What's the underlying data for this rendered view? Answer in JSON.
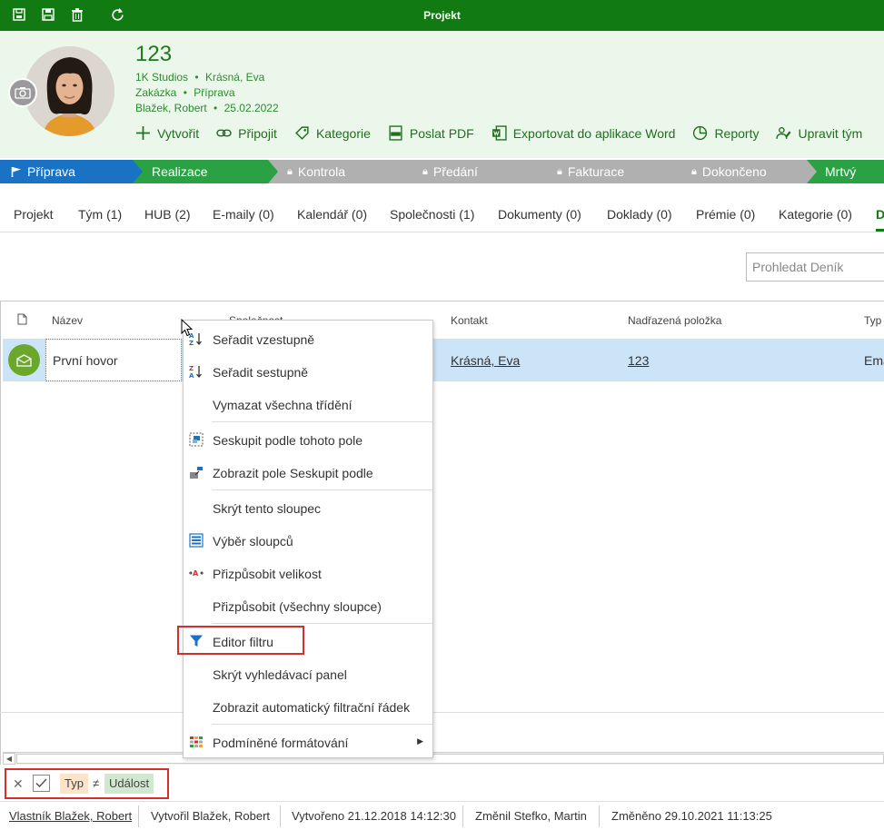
{
  "window": {
    "title": "Projekt"
  },
  "project": {
    "name": "123",
    "line1": {
      "company": "1K Studios",
      "contact": "Krásná, Eva"
    },
    "line2": {
      "type": "Zakázka",
      "stage": "Příprava"
    },
    "line3": {
      "owner": "Blažek, Robert",
      "date": "25.02.2022"
    },
    "separator": "•"
  },
  "actions": [
    {
      "label": "Vytvořit",
      "icon": "plus-icon"
    },
    {
      "label": "Připojit",
      "icon": "link-icon"
    },
    {
      "label": "Kategorie",
      "icon": "tag-icon"
    },
    {
      "label": "Poslat PDF",
      "icon": "pdf-icon"
    },
    {
      "label": "Exportovat do aplikace Word",
      "icon": "word-icon"
    },
    {
      "label": "Reporty",
      "icon": "chart-icon"
    },
    {
      "label": "Upravit tým",
      "icon": "team-icon"
    }
  ],
  "stages": [
    {
      "label": "Příprava",
      "color": "#1a72c4",
      "locked": false
    },
    {
      "label": "Realizace",
      "color": "#2aa244",
      "locked": false
    },
    {
      "label": "Kontrola",
      "color": "#b0b0b0",
      "locked": true
    },
    {
      "label": "Předání",
      "color": "#b0b0b0",
      "locked": true
    },
    {
      "label": "Fakturace",
      "color": "#b0b0b0",
      "locked": true
    },
    {
      "label": "Dokončeno",
      "color": "#b0b0b0",
      "locked": true
    },
    {
      "label": "Mrtvý",
      "color": "#2aa244",
      "locked": false
    }
  ],
  "tabs": [
    "Projekt",
    "Tým (1)",
    "HUB (2)",
    "E-maily (0)",
    "Kalendář (0)",
    "Společnosti (1)",
    "Dokumenty (0)",
    "Doklady (0)",
    "Prémie (0)",
    "Kategorie (0)",
    "D"
  ],
  "search": {
    "placeholder": "Prohledat Deník"
  },
  "grid": {
    "columns": [
      "Název",
      "Společnost",
      "Kontakt",
      "Nadřazená položka",
      "Typ"
    ],
    "rows": [
      {
        "name": "První hovor",
        "contact": "Krásná, Eva",
        "parent": "123",
        "type": "Ema"
      }
    ]
  },
  "context_menu": {
    "items": [
      {
        "label": "Seřadit vzestupně",
        "icon": "sort-ascending-icon"
      },
      {
        "label": "Seřadit sestupně",
        "icon": "sort-descending-icon"
      },
      {
        "label": "Vymazat všechna třídění",
        "icon": ""
      },
      {
        "label": "Seskupit podle tohoto pole",
        "icon": "group-by-icon"
      },
      {
        "label": "Zobrazit pole Seskupit podle",
        "icon": "group-panel-icon"
      },
      {
        "label": "Skrýt tento sloupec",
        "icon": ""
      },
      {
        "label": "Výběr sloupců",
        "icon": "column-chooser-icon"
      },
      {
        "label": "Přizpůsobit velikost",
        "icon": "best-fit-icon"
      },
      {
        "label": "Přizpůsobit (všechny sloupce)",
        "icon": ""
      },
      {
        "label": "Editor filtru",
        "icon": "filter-icon"
      },
      {
        "label": "Skrýt vyhledávací panel",
        "icon": ""
      },
      {
        "label": "Zobrazit automatický filtrační řádek",
        "icon": ""
      },
      {
        "label": "Podmíněné formátování",
        "icon": "conditional-format-icon"
      }
    ]
  },
  "filter": {
    "field": "Typ",
    "operator": "≠",
    "value": "Událost"
  },
  "status": {
    "owner": "Vlastník Blažek, Robert",
    "created_by": "Vytvořil Blažek, Robert",
    "created": "Vytvořeno 21.12.2018 14:12:30",
    "modified_by": "Změnil Stefko, Martin",
    "modified": "Změněno 29.10.2021 11:13:25"
  }
}
